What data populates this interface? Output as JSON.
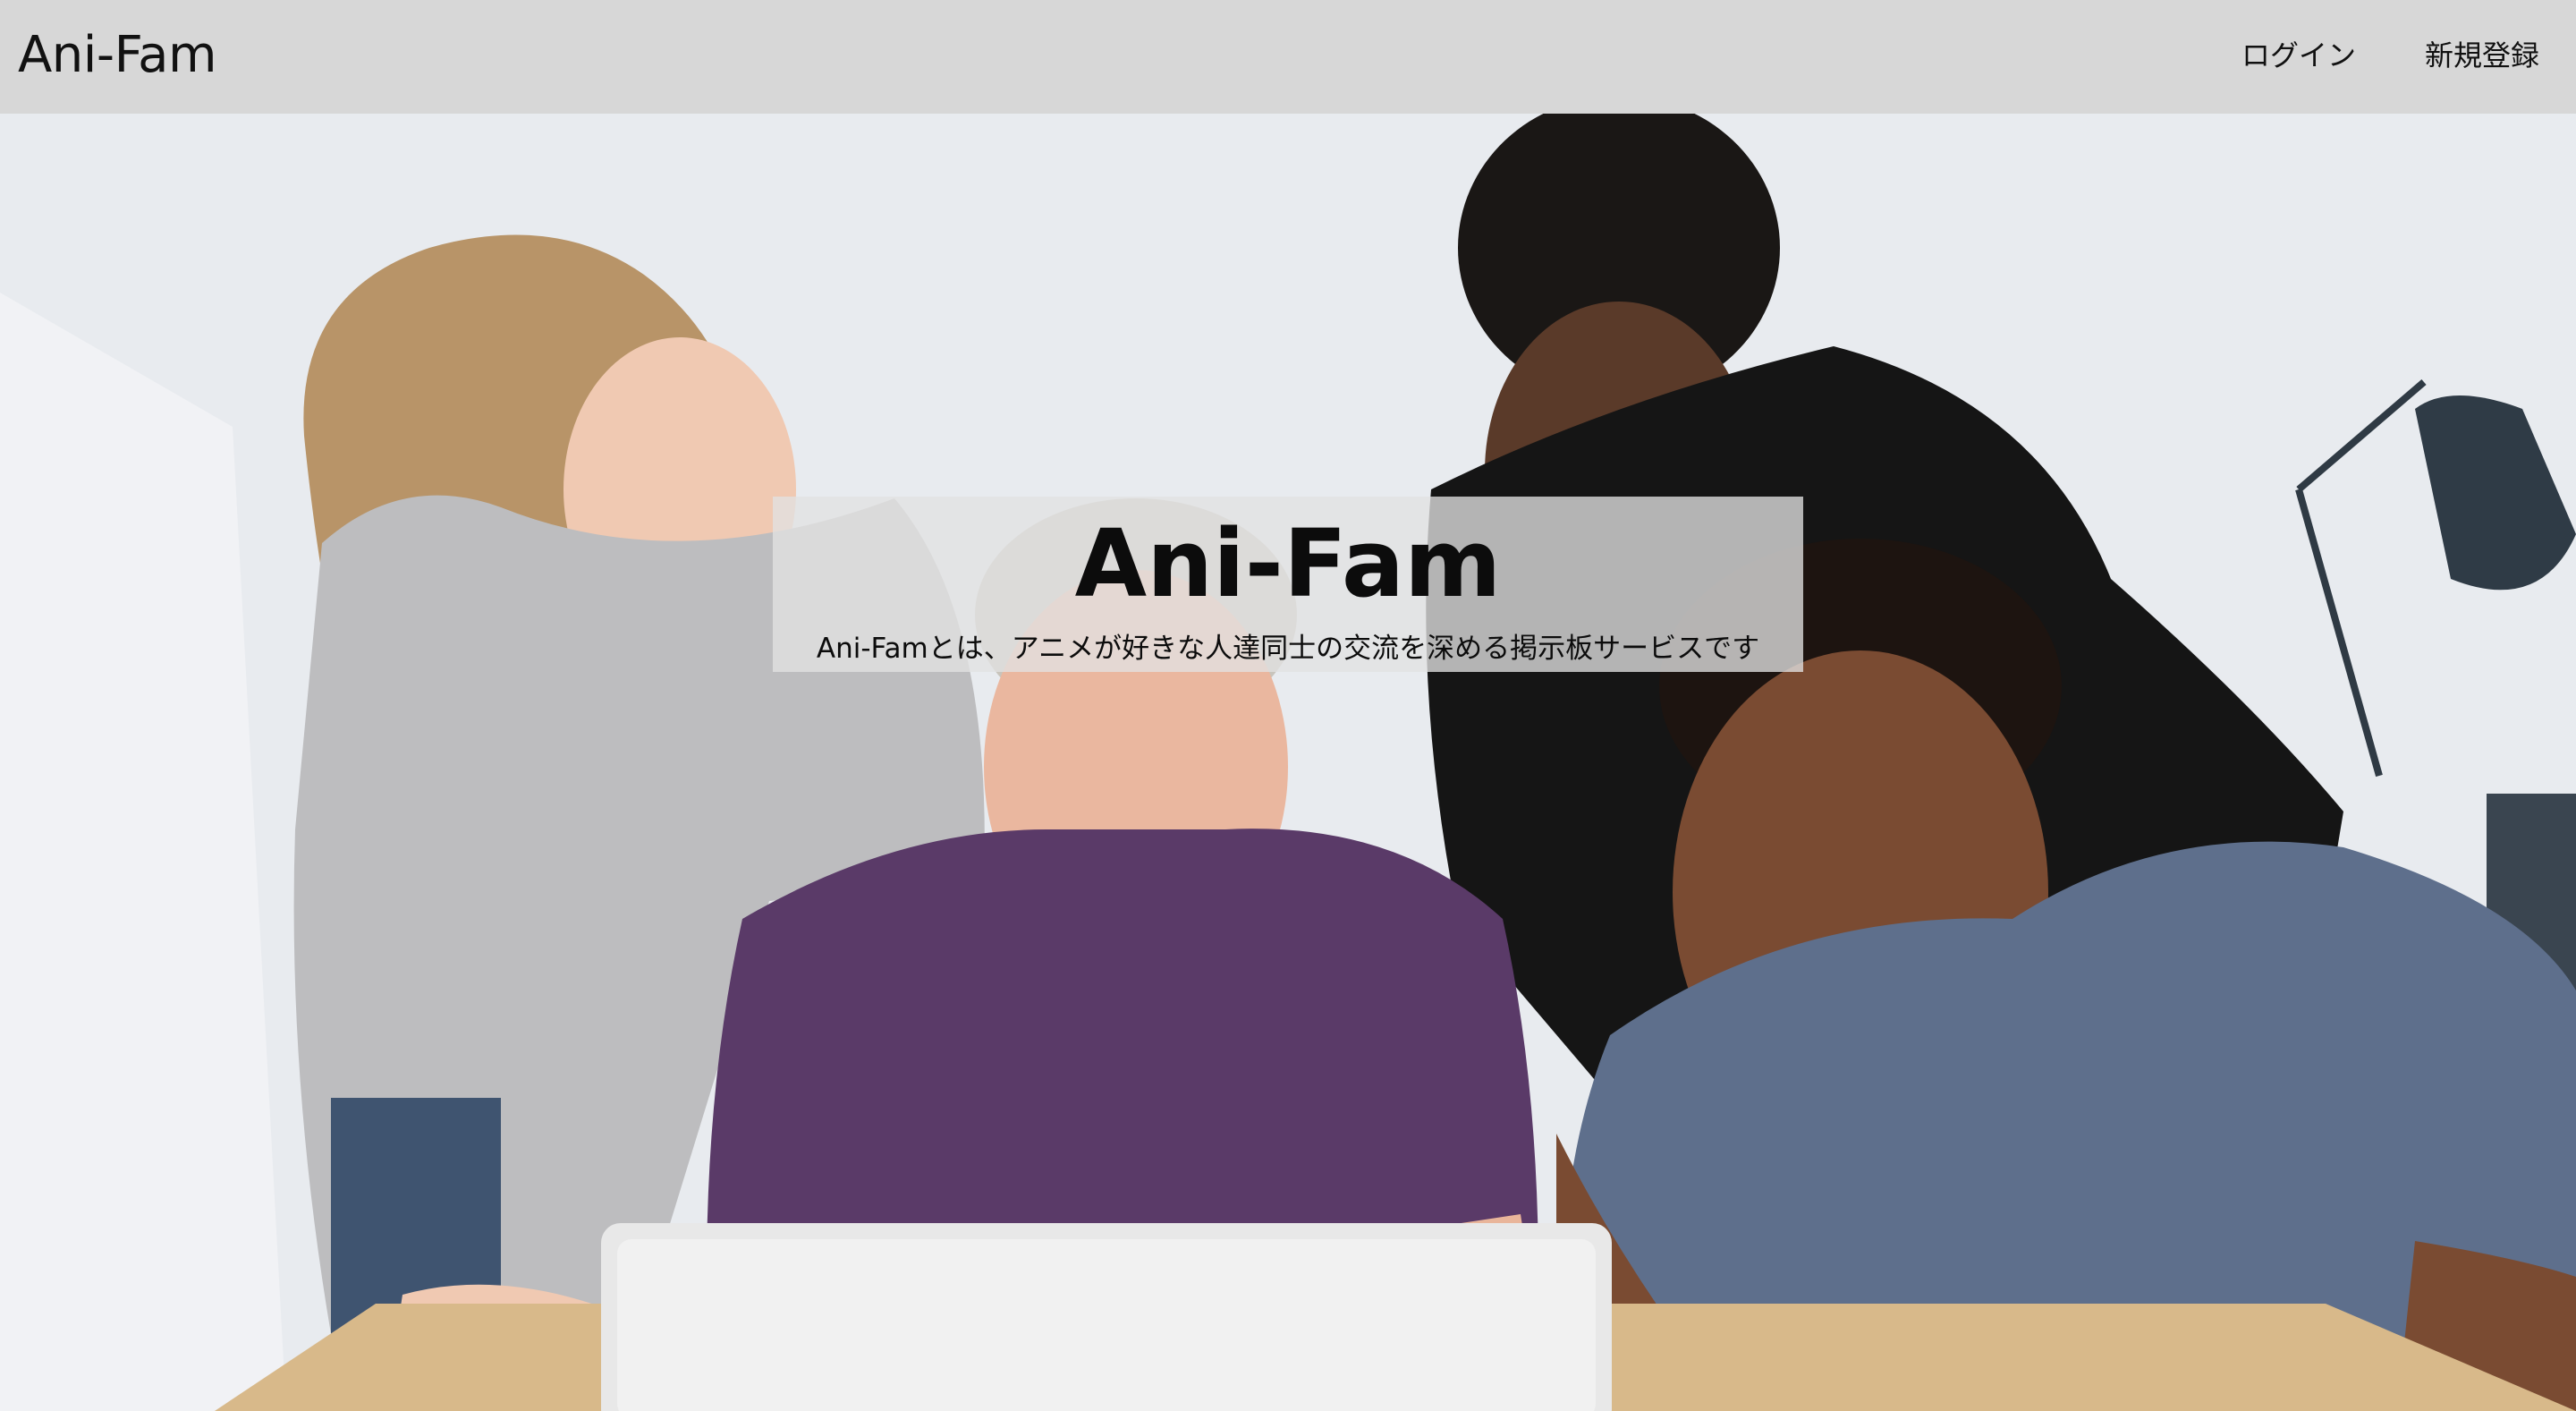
{
  "header": {
    "logo": "Ani-Fam",
    "nav": {
      "login": "ログイン",
      "signup": "新規登録"
    }
  },
  "hero": {
    "title": "Ani-Fam",
    "subtitle": "Ani-Famとは、アニメが好きな人達同士の交流を深める掲示板サービスです",
    "background_image": "photo of four people smiling at a laptop"
  },
  "colors": {
    "header_bg": "#d7d7d7",
    "text": "#111111",
    "hero_box_bg": "rgba(225,225,225,0.78)"
  }
}
